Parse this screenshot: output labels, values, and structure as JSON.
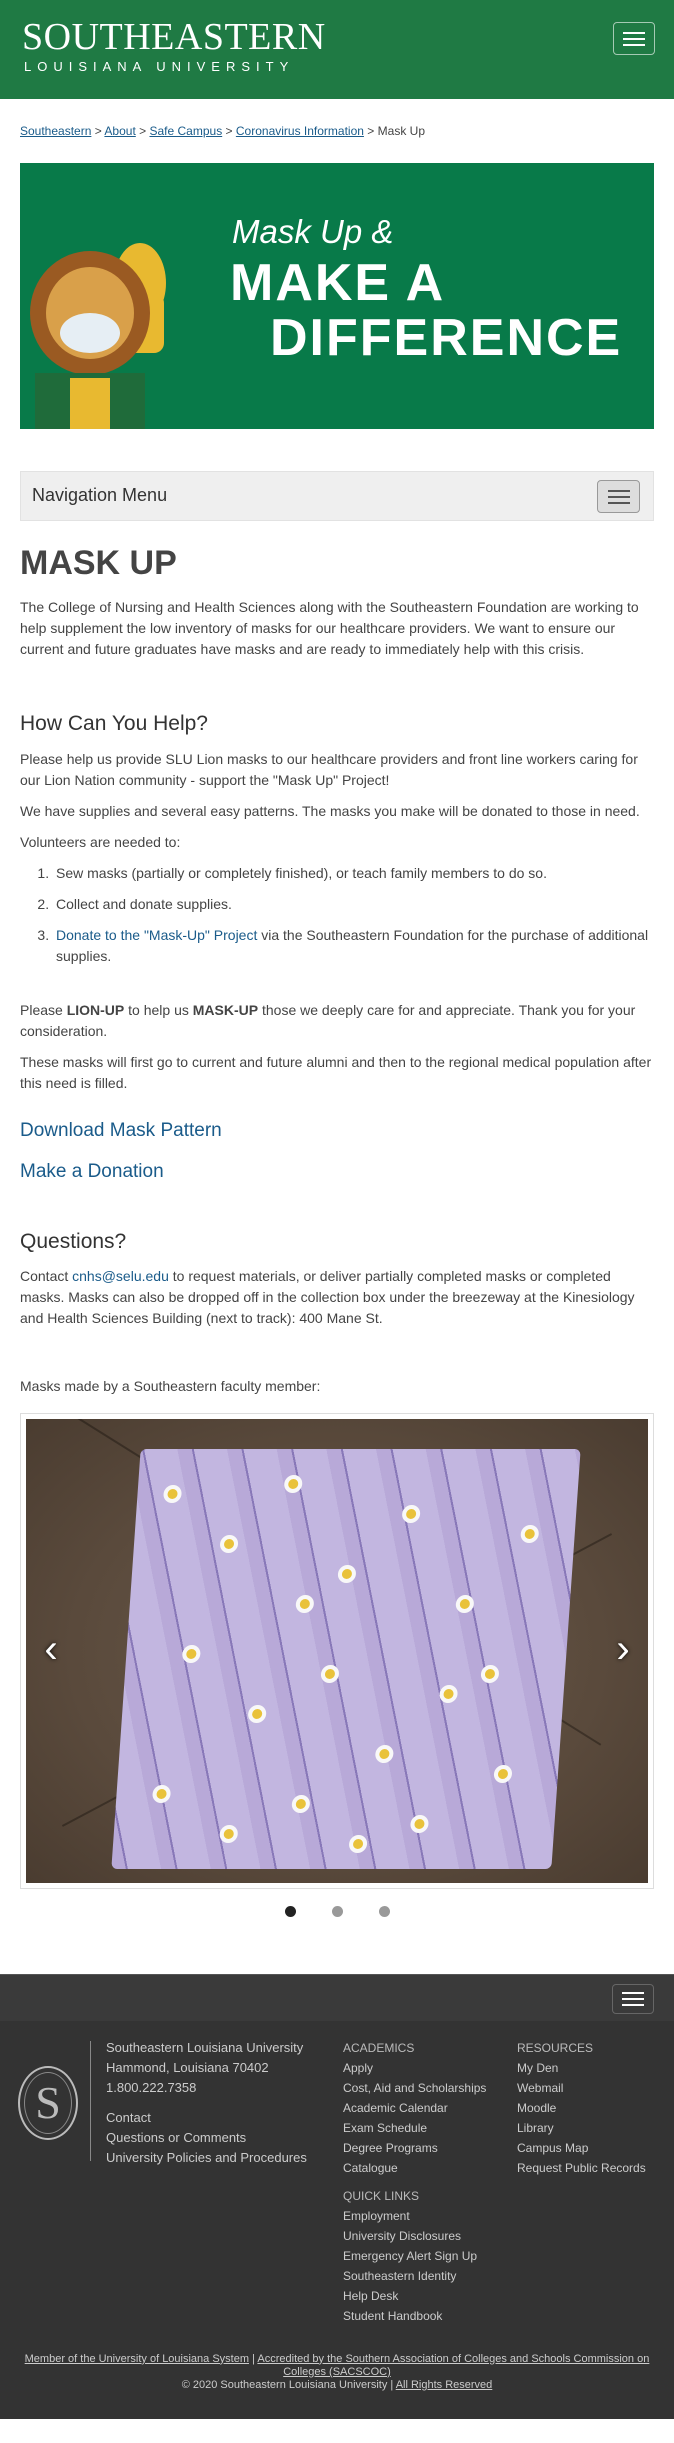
{
  "header": {
    "logo_main": "SOUTHEASTERN",
    "logo_sub": "LOUISIANA UNIVERSITY"
  },
  "breadcrumb": {
    "items": [
      "Southeastern",
      "About",
      "Safe Campus",
      "Coronavirus Information"
    ],
    "current": "Mask Up",
    "separator": ">"
  },
  "banner": {
    "line1": "Mask Up &",
    "line2": "MAKE A",
    "line3": "DIFFERENCE"
  },
  "nav_menu": {
    "title": "Navigation Menu"
  },
  "page": {
    "title": "MASK UP",
    "intro": "The College of Nursing and Health Sciences along with the Southeastern Foundation are working to help supplement the low inventory of masks for our healthcare providers.  We want to ensure our current and future graduates have masks and are ready to immediately help with this crisis.",
    "help_title": "How Can You Help?",
    "help_p1": "Please help us provide SLU Lion masks to our healthcare providers and front line workers caring for our Lion Nation community - support the \"Mask Up\" Project!",
    "help_p2": "We have supplies and several easy patterns.  The masks you make will be donated to those in need.",
    "volunteers": "Volunteers are needed to:",
    "list": {
      "item1": "Sew masks (partially or completely finished), or teach family members to do so.",
      "item2": "Collect and donate supplies.",
      "item3_link": "Donate to the \"Mask-Up\" Project",
      "item3_rest": " via the Southeastern Foundation for the purchase of additional supplies."
    },
    "lion_p": {
      "pre": "Please ",
      "bold1": "LION-UP",
      "mid": " to help us ",
      "bold2": "MASK-UP",
      "post": " those we deeply care for and appreciate.  Thank you for your consideration."
    },
    "alumni_p": "These masks will first go to current and future alumni and then to the regional medical population after this need is filled.",
    "download_link": "Download Mask Pattern",
    "donation_link": "Make a Donation",
    "questions_title": "Questions?",
    "questions_p": {
      "pre": "Contact ",
      "email": "cnhs@selu.edu",
      "post": " to request materials, or deliver partially completed masks or completed masks.  Masks can also be dropped off in the collection box under the breezeway at the Kinesiology and Health Sciences Building (next to track): 400 Mane St."
    },
    "masks_caption": "Masks made by a Southeastern faculty member:"
  },
  "carousel": {
    "prev_glyph": "‹",
    "next_glyph": "›",
    "active_index": 0,
    "count": 3
  },
  "footer": {
    "seal_letter": "S",
    "address": {
      "name": "Southeastern Louisiana University",
      "city": "Hammond, Louisiana 70402",
      "phone": "1.800.222.7358",
      "links": [
        "Contact",
        "Questions or Comments",
        "University Policies and Procedures"
      ]
    },
    "academics": {
      "heading": "ACADEMICS",
      "links": [
        "Apply",
        "Cost, Aid and Scholarships",
        "Academic Calendar",
        "Exam Schedule",
        "Degree Programs",
        "Catalogue"
      ]
    },
    "resources": {
      "heading": "RESOURCES",
      "links": [
        "My Den",
        "Webmail",
        "Moodle",
        "Library",
        "Campus Map",
        "Request Public Records"
      ]
    },
    "quick_links": {
      "heading": "QUICK LINKS",
      "links": [
        "Employment",
        "University Disclosures",
        "Emergency Alert Sign Up",
        "Southeastern Identity",
        "Help Desk",
        "Student Handbook"
      ]
    },
    "bottom": {
      "member_link": "Member of the University of Louisiana System",
      "sep": " | ",
      "accredited_link": "Accredited by the Southern Association of Colleges and Schools Commission on Colleges (SACSCOC)",
      "copyright": "© 2020 Southeastern Louisiana University",
      "sep2": "  |  ",
      "rights_link": "All Rights Reserved"
    }
  },
  "colors": {
    "brand_green": "#1f7a44",
    "banner_green": "#087a49",
    "link_blue": "#1a5b8a",
    "footer_dark": "#333333"
  }
}
